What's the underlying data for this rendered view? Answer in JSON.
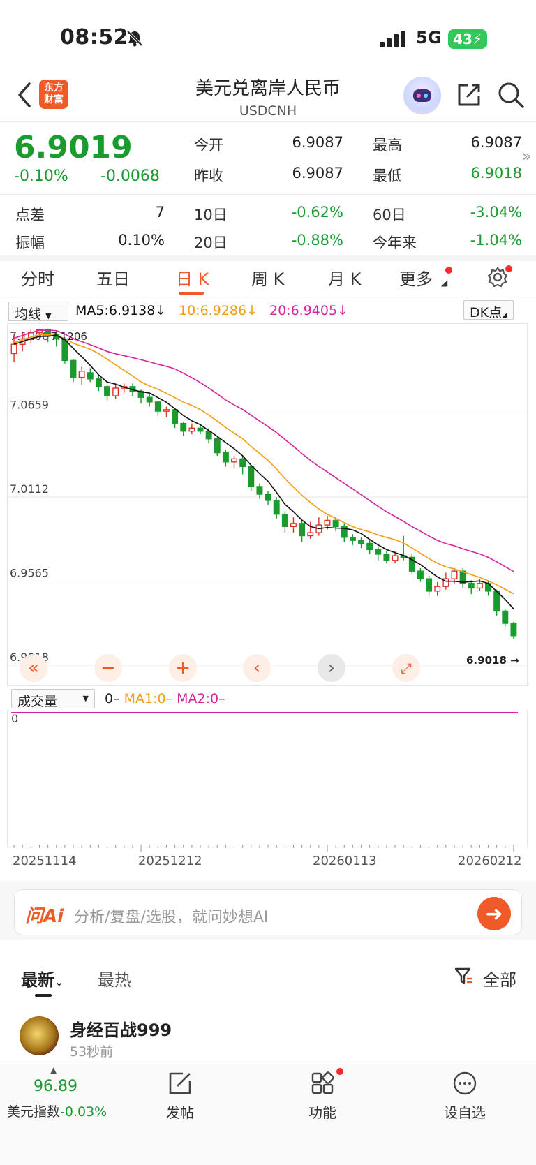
{
  "status": {
    "time": "08:52",
    "network": "5G",
    "battery": "43"
  },
  "header": {
    "logo_line1": "东方",
    "logo_line2": "财富",
    "title": "美元兑离岸人民币",
    "subtitle": "USDCNH"
  },
  "quote": {
    "price": "6.9019",
    "change_pct": "-0.10%",
    "change": "-0.0068",
    "open_label": "今开",
    "open": "6.9087",
    "high_label": "最高",
    "high": "6.9087",
    "prev_label": "昨收",
    "prev": "6.9087",
    "low_label": "最低",
    "low": "6.9018",
    "spread_label": "点差",
    "spread": "7",
    "d10_label": "10日",
    "d10": "-0.62%",
    "d60_label": "60日",
    "d60": "-3.04%",
    "amp_label": "振幅",
    "amp": "0.10%",
    "d20_label": "20日",
    "d20": "-0.88%",
    "ytd_label": "今年来",
    "ytd": "-1.04%"
  },
  "tabs": [
    "分时",
    "五日",
    "日 K",
    "周 K",
    "月 K",
    "更多"
  ],
  "indicators": {
    "selector": "均线",
    "ma5": "MA5:6.9138",
    "ma10": "10:6.9286",
    "ma20": "20:6.9405",
    "dk": "DK点",
    "vol_selector": "成交量",
    "vol_val": "0",
    "vol_ma1": "MA1:0",
    "vol_ma2": "MA2:0",
    "vol_axis": "0"
  },
  "colors": {
    "up": "#e0302a",
    "down": "#1a9b2e",
    "ma5": "#111111",
    "ma10": "#f39c12",
    "ma20": "#d6249f",
    "accent": "#f05a28"
  },
  "chart_data": {
    "type": "candlestick",
    "y_ticks": [
      "7.1206",
      "7.0659",
      "7.0112",
      "6.9565",
      "6.9018"
    ],
    "ylim": [
      6.9018,
      7.1206
    ],
    "max_label": "7.1206",
    "min_label": "6.9018",
    "x_ticks": [
      "20251114",
      "20251212",
      "20260113",
      "20260212"
    ],
    "candles": [
      [
        7.1045,
        7.1105,
        7.117,
        7.099
      ],
      [
        7.1105,
        7.114,
        7.118,
        7.106
      ],
      [
        7.114,
        7.118,
        7.1205,
        7.111
      ],
      [
        7.118,
        7.12,
        7.1206,
        7.114
      ],
      [
        7.12,
        7.116,
        7.1206,
        7.112
      ],
      [
        7.117,
        7.114,
        7.119,
        7.109
      ],
      [
        7.114,
        7.1,
        7.115,
        7.098
      ],
      [
        7.1,
        7.089,
        7.101,
        7.086
      ],
      [
        7.089,
        7.093,
        7.096,
        7.084
      ],
      [
        7.092,
        7.088,
        7.095,
        7.086
      ],
      [
        7.088,
        7.083,
        7.09,
        7.08
      ],
      [
        7.083,
        7.077,
        7.084,
        7.074
      ],
      [
        7.077,
        7.082,
        7.085,
        7.075
      ],
      [
        7.082,
        7.083,
        7.085,
        7.079
      ],
      [
        7.083,
        7.08,
        7.085,
        7.077
      ],
      [
        7.08,
        7.076,
        7.081,
        7.072
      ],
      [
        7.076,
        7.073,
        7.078,
        7.07
      ],
      [
        7.073,
        7.067,
        7.074,
        7.064
      ],
      [
        7.067,
        7.068,
        7.07,
        7.063
      ],
      [
        7.068,
        7.059,
        7.069,
        7.056
      ],
      [
        7.059,
        7.054,
        7.06,
        7.051
      ],
      [
        7.054,
        7.056,
        7.059,
        7.052
      ],
      [
        7.056,
        7.054,
        7.058,
        7.052
      ],
      [
        7.054,
        7.049,
        7.056,
        7.046
      ],
      [
        7.049,
        7.04,
        7.05,
        7.038
      ],
      [
        7.04,
        7.034,
        7.042,
        7.031
      ],
      [
        7.034,
        7.036,
        7.038,
        7.03
      ],
      [
        7.036,
        7.031,
        7.038,
        7.026
      ],
      [
        7.031,
        7.018,
        7.032,
        7.015
      ],
      [
        7.018,
        7.013,
        7.02,
        7.01
      ],
      [
        7.013,
        7.009,
        7.015,
        7.006
      ],
      [
        7.009,
        7.0,
        7.011,
        6.997
      ],
      [
        7.0,
        6.992,
        7.002,
        6.988
      ],
      [
        6.992,
        6.994,
        6.998,
        6.988
      ],
      [
        6.994,
        6.986,
        6.996,
        6.982
      ],
      [
        6.986,
        6.988,
        6.995,
        6.984
      ],
      [
        6.988,
        6.993,
        6.998,
        6.986
      ],
      [
        6.993,
        6.996,
        6.999,
        6.99
      ],
      [
        6.996,
        6.992,
        6.998,
        6.989
      ],
      [
        6.992,
        6.985,
        6.994,
        6.982
      ],
      [
        6.985,
        6.983,
        6.987,
        6.98
      ],
      [
        6.983,
        6.981,
        6.985,
        6.978
      ],
      [
        6.981,
        6.977,
        6.983,
        6.974
      ],
      [
        6.977,
        6.974,
        6.979,
        6.97
      ],
      [
        6.974,
        6.97,
        6.976,
        6.968
      ],
      [
        6.97,
        6.973,
        6.976,
        6.968
      ],
      [
        6.973,
        6.972,
        6.986,
        6.97
      ],
      [
        6.972,
        6.963,
        6.974,
        6.961
      ],
      [
        6.963,
        6.958,
        6.965,
        6.956
      ],
      [
        6.958,
        6.95,
        6.96,
        6.947
      ],
      [
        6.95,
        6.953,
        6.956,
        6.947
      ],
      [
        6.953,
        6.958,
        6.962,
        6.951
      ],
      [
        6.958,
        6.963,
        6.965,
        6.955
      ],
      [
        6.963,
        6.955,
        6.965,
        6.952
      ],
      [
        6.955,
        6.952,
        6.957,
        6.948
      ],
      [
        6.952,
        6.955,
        6.958,
        6.95
      ],
      [
        6.955,
        6.95,
        6.957,
        6.947
      ],
      [
        6.95,
        6.937,
        6.951,
        6.934
      ],
      [
        6.937,
        6.929,
        6.938,
        6.927
      ],
      [
        6.929,
        6.921,
        6.93,
        6.919
      ]
    ]
  },
  "controls": [
    "double-left",
    "zoom-out",
    "zoom-in",
    "prev",
    "next",
    "expand"
  ],
  "ai": {
    "logo": "问Ai",
    "placeholder": "分析/复盘/选股，就问妙想AI"
  },
  "feed": {
    "tab_latest": "最新",
    "tab_hot": "最热",
    "filter": "全部",
    "user": "身经百战999",
    "time": "53秒前"
  },
  "bottom": {
    "index_value": "96.89",
    "index_label": "美元指数",
    "index_change": "-0.03%",
    "post": "发帖",
    "func": "功能",
    "watch": "设自选"
  }
}
